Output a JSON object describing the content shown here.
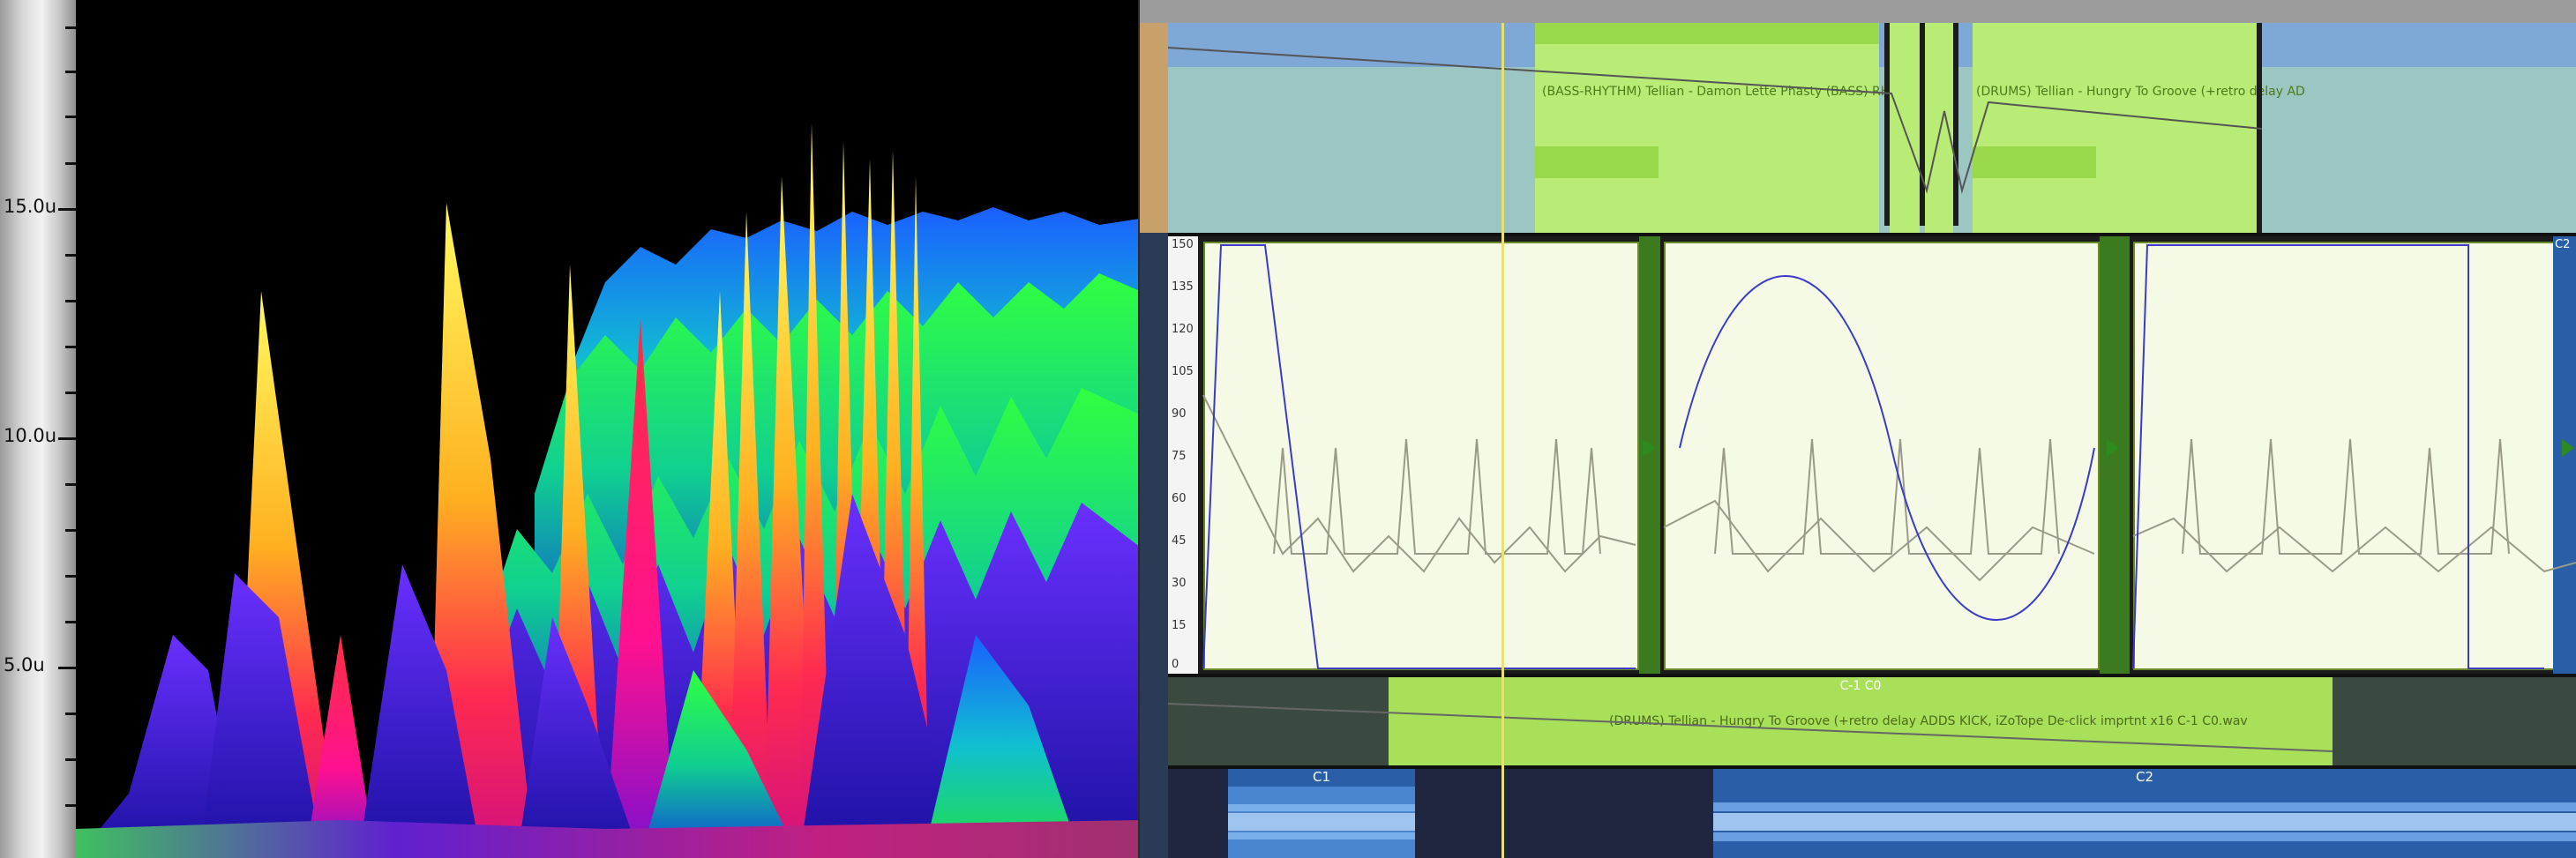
{
  "left_panel": {
    "ruler_labels": [
      "15.0u",
      "10.0u",
      "5.0u"
    ]
  },
  "arrangement": {
    "track1": {
      "clip_bass_name": "(BASS-RHYTHM) Tellian - Damon Lette Phasty (BASS) RHYTHM",
      "clip_drums_name": "(DRUMS) Tellian - Hungry To Groove (+retro delay AD"
    },
    "track2": {
      "y_axis_labels": [
        "150",
        "135",
        "120",
        "105",
        "90",
        "75",
        "60",
        "45",
        "30",
        "15",
        "0"
      ],
      "badge": "C2"
    },
    "track3": {
      "clip_header": "C-1 C0",
      "clip_name": "(DRUMS) Tellian - Hungry To Groove (+retro delay ADDS KICK, iZoTope De-click imprtnt  x16 C-1 C0.wav"
    },
    "track4": {
      "clip_c1_label": "C1",
      "clip_c2_label": "C2"
    }
  },
  "colors": {
    "clip_green": "#a8e05a",
    "clip_green_light": "#c4ec86",
    "lane_blue": "#7ea8d6",
    "lane_teal": "#9cc6c2",
    "playhead": "#e8e070",
    "envelope_line": "#3b3bc8",
    "waveform_blue": "#2a5fa8"
  }
}
